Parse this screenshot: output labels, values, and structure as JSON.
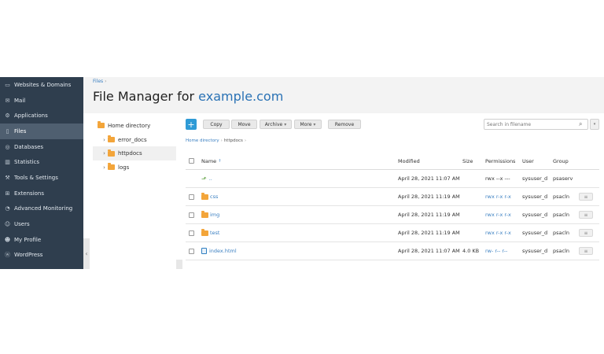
{
  "sidebar": {
    "items": [
      {
        "label": "Websites & Domains",
        "icon": "monitor-icon"
      },
      {
        "label": "Mail",
        "icon": "mail-icon"
      },
      {
        "label": "Applications",
        "icon": "gear-icon"
      },
      {
        "label": "Files",
        "icon": "file-icon",
        "active": true
      },
      {
        "label": "Databases",
        "icon": "database-icon"
      },
      {
        "label": "Statistics",
        "icon": "chart-icon"
      },
      {
        "label": "Tools & Settings",
        "icon": "tools-icon"
      },
      {
        "label": "Extensions",
        "icon": "extensions-icon"
      },
      {
        "label": "Advanced Monitoring",
        "icon": "monitoring-icon"
      },
      {
        "label": "Users",
        "icon": "user-icon"
      },
      {
        "label": "My Profile",
        "icon": "profile-icon"
      },
      {
        "label": "WordPress",
        "icon": "wordpress-icon"
      }
    ],
    "collapse_glyph": "‹"
  },
  "header": {
    "breadcrumb": "Files",
    "breadcrumb_sep": "›",
    "title_prefix": "File Manager for",
    "title_domain": "example.com"
  },
  "tree": {
    "root": "Home directory",
    "children": [
      {
        "label": "error_docs",
        "caret": "›"
      },
      {
        "label": "httpdocs",
        "caret": "›",
        "selected": true
      },
      {
        "label": "logs",
        "caret": "›"
      }
    ]
  },
  "toolbar": {
    "add": "+",
    "copy": "Copy",
    "move": "Move",
    "archive": "Archive",
    "more": "More",
    "remove": "Remove",
    "dropdown_glyph": "▾"
  },
  "search": {
    "placeholder": "Search in filename",
    "value": "",
    "icon": "⌕",
    "options_glyph": "▾"
  },
  "path": {
    "root": "Home directory",
    "current": "httpdocs",
    "sep": "›"
  },
  "table": {
    "columns": {
      "name": "Name",
      "sort_arrow": "↑",
      "modified": "Modified",
      "size": "Size",
      "permissions": "Permissions",
      "user": "User",
      "group": "Group"
    },
    "rows": [
      {
        "kind": "up",
        "name": "..",
        "modified": "April 28, 2021 11:07 AM",
        "size": "",
        "permissions": "rwx --x ---",
        "perm_link": false,
        "user": "sysuser_d",
        "group": "psaserv"
      },
      {
        "kind": "folder",
        "name": "css",
        "modified": "April 28, 2021 11:19 AM",
        "size": "",
        "permissions": "rwx r-x r-x",
        "perm_link": true,
        "user": "sysuser_d",
        "group": "psacln"
      },
      {
        "kind": "folder",
        "name": "img",
        "modified": "April 28, 2021 11:19 AM",
        "size": "",
        "permissions": "rwx r-x r-x",
        "perm_link": true,
        "user": "sysuser_d",
        "group": "psacln"
      },
      {
        "kind": "folder",
        "name": "test",
        "modified": "April 28, 2021 11:19 AM",
        "size": "",
        "permissions": "rwx r-x r-x",
        "perm_link": true,
        "user": "sysuser_d",
        "group": "psacln"
      },
      {
        "kind": "file",
        "name": "index.html",
        "modified": "April 28, 2021 11:07 AM",
        "size": "4.0 KB",
        "permissions": "rw- r-- r--",
        "perm_link": true,
        "user": "sysuser_d",
        "group": "psacln"
      }
    ],
    "action_glyph": "≡"
  }
}
